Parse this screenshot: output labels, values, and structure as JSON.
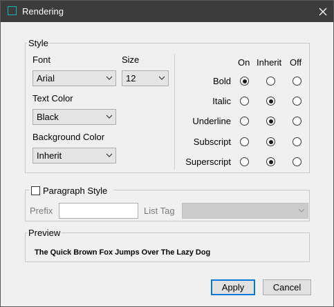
{
  "window": {
    "title": "Rendering"
  },
  "style": {
    "legend": "Style",
    "font_label": "Font",
    "font_value": "Arial",
    "size_label": "Size",
    "size_value": "12",
    "text_color_label": "Text Color",
    "text_color_value": "Black",
    "bg_color_label": "Background Color",
    "bg_color_value": "Inherit",
    "columns": {
      "on": "On",
      "inherit": "Inherit",
      "off": "Off"
    },
    "attributes": [
      {
        "label": "Bold",
        "selected": "on"
      },
      {
        "label": "Italic",
        "selected": "inherit"
      },
      {
        "label": "Underline",
        "selected": "inherit"
      },
      {
        "label": "Subscript",
        "selected": "inherit"
      },
      {
        "label": "Superscript",
        "selected": "inherit"
      }
    ]
  },
  "paragraph": {
    "checkbox_label": "Paragraph Style",
    "checked": false,
    "prefix_label": "Prefix",
    "prefix_value": "",
    "list_tag_label": "List Tag",
    "list_tag_value": ""
  },
  "preview": {
    "legend": "Preview",
    "text": "The Quick Brown Fox Jumps Over The Lazy Dog"
  },
  "buttons": {
    "apply": "Apply",
    "cancel": "Cancel"
  },
  "colors": {
    "titlebar": "#3c3c3c",
    "accent": "#17b5b8",
    "focus": "#0078d7",
    "dialog": "#f0f0f0"
  }
}
